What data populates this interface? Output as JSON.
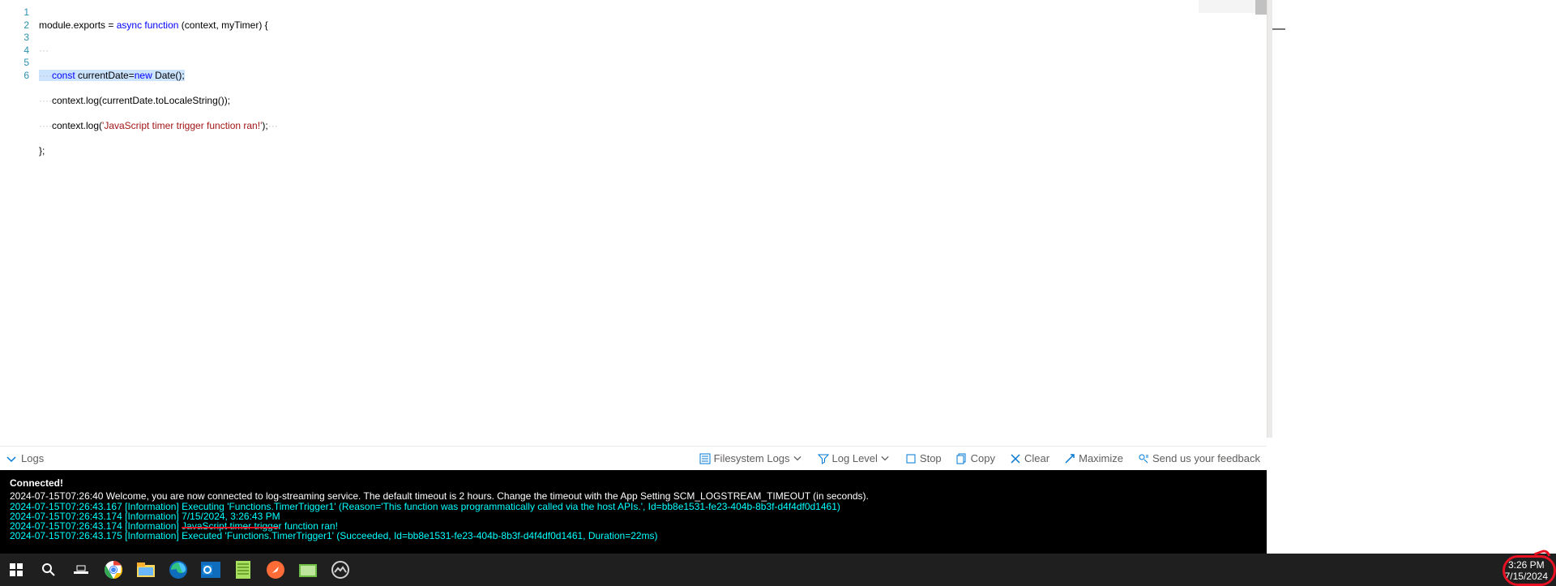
{
  "editor": {
    "lines": [
      {
        "n": "1",
        "t": "module.exports = async function (context, myTimer) {"
      },
      {
        "n": "2",
        "t": "···"
      },
      {
        "n": "3",
        "t": "····const currentDate=new Date();"
      },
      {
        "n": "4",
        "t": "····context.log(currentDate.toLocaleString());"
      },
      {
        "n": "5",
        "t": "····context.log('JavaScript timer trigger function ran!');···"
      },
      {
        "n": "6",
        "t": "};"
      }
    ]
  },
  "logs_bar": {
    "toggle_label": "Logs",
    "filesystem_logs": "Filesystem Logs",
    "log_level": "Log Level",
    "stop": "Stop",
    "copy": "Copy",
    "clear": "Clear",
    "maximize": "Maximize",
    "feedback": "Send us your feedback"
  },
  "console": {
    "connected": "Connected!",
    "welcome_ts": "2024-07-15T07:26:40",
    "welcome_msg": "  Welcome, you are now connected to log-streaming service. The default timeout is 2 hours. Change the timeout with the App Setting SCM_LOGSTREAM_TIMEOUT (in seconds).",
    "l1_ts": "2024-07-15T07:26:43.167 [Information] ",
    "l1_msg": "Executing 'Functions.TimerTrigger1' (Reason='This function was programmatically called via the host APIs.', Id=bb8e1531-fe23-404b-8b3f-d4f4df0d1461)",
    "l2_ts": "2024-07-15T07:26:43.174 [Information] ",
    "l2_msg_a": "7/15/2024, 3:26:43 PM",
    "l3_ts": "2024-07-15T07:26:43.174 [Information] ",
    "l3_msg_a": "JavaScript timer trigge",
    "l3_msg_b": "r function ran!",
    "l4_ts": "2024-07-15T07:26:43.175 [Information] ",
    "l4_msg": "Executed 'Functions.TimerTrigger1' (Succeeded, Id=bb8e1531-fe23-404b-8b3f-d4f4df0d1461, Duration=22ms)"
  },
  "taskbar": {
    "time": "3:26 PM",
    "date": "7/15/2024"
  }
}
